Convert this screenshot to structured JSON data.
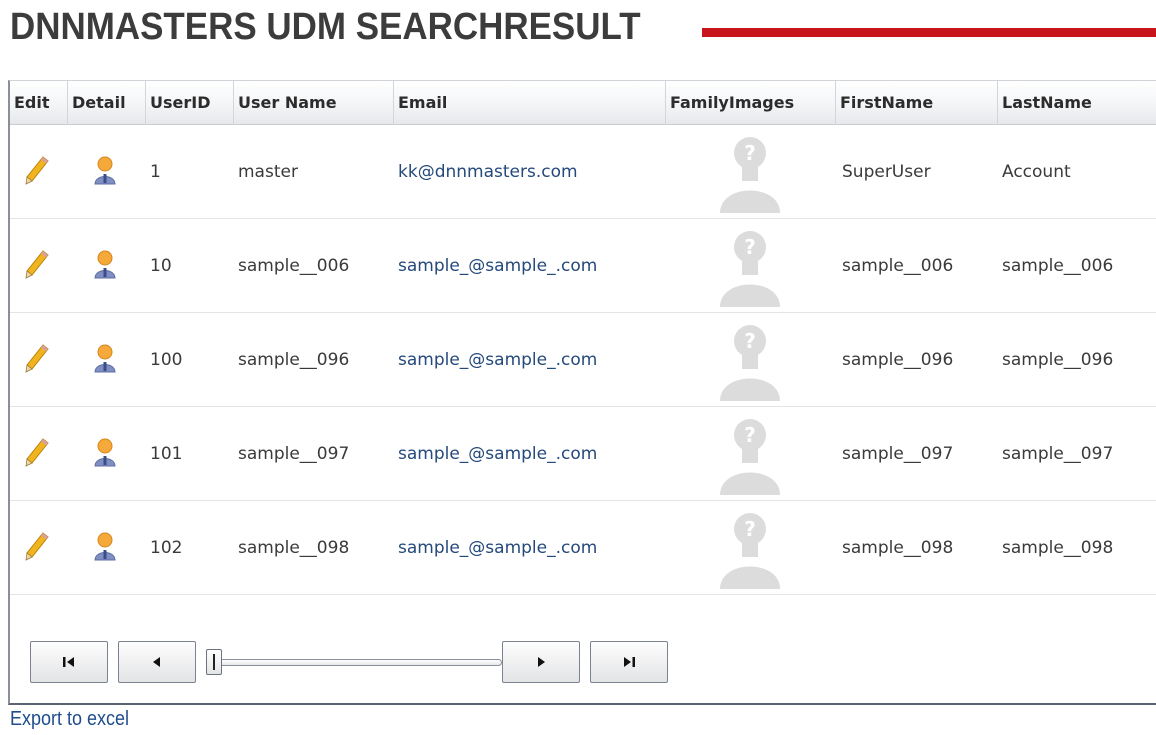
{
  "page": {
    "title": "DNNMASTERS UDM SEARCHRESULT",
    "accent_color": "#c8141c"
  },
  "grid": {
    "columns": [
      "Edit",
      "Detail",
      "UserID",
      "User Name",
      "Email",
      "FamilyImages",
      "FirstName",
      "LastName"
    ],
    "rows": [
      {
        "user_id": "1",
        "user_name": "master",
        "email": "kk@dnnmasters.com",
        "first_name": "SuperUser",
        "last_name": "Account"
      },
      {
        "user_id": "10",
        "user_name": "sample__006",
        "email": "sample_@sample_.com",
        "first_name": "sample__006",
        "last_name": "sample__006"
      },
      {
        "user_id": "100",
        "user_name": "sample__096",
        "email": "sample_@sample_.com",
        "first_name": "sample__096",
        "last_name": "sample__096"
      },
      {
        "user_id": "101",
        "user_name": "sample__097",
        "email": "sample_@sample_.com",
        "first_name": "sample__097",
        "last_name": "sample__097"
      },
      {
        "user_id": "102",
        "user_name": "sample__098",
        "email": "sample_@sample_.com",
        "first_name": "sample__098",
        "last_name": "sample__098"
      }
    ],
    "row_icons": {
      "edit": "pencil-icon",
      "detail": "user-icon",
      "family_image": "placeholder-avatar-icon"
    }
  },
  "pager": {
    "buttons": [
      "first-page-icon",
      "prev-page-icon",
      "next-page-icon",
      "last-page-icon"
    ],
    "slider_position": 0
  },
  "export": {
    "label": "Export to excel"
  }
}
